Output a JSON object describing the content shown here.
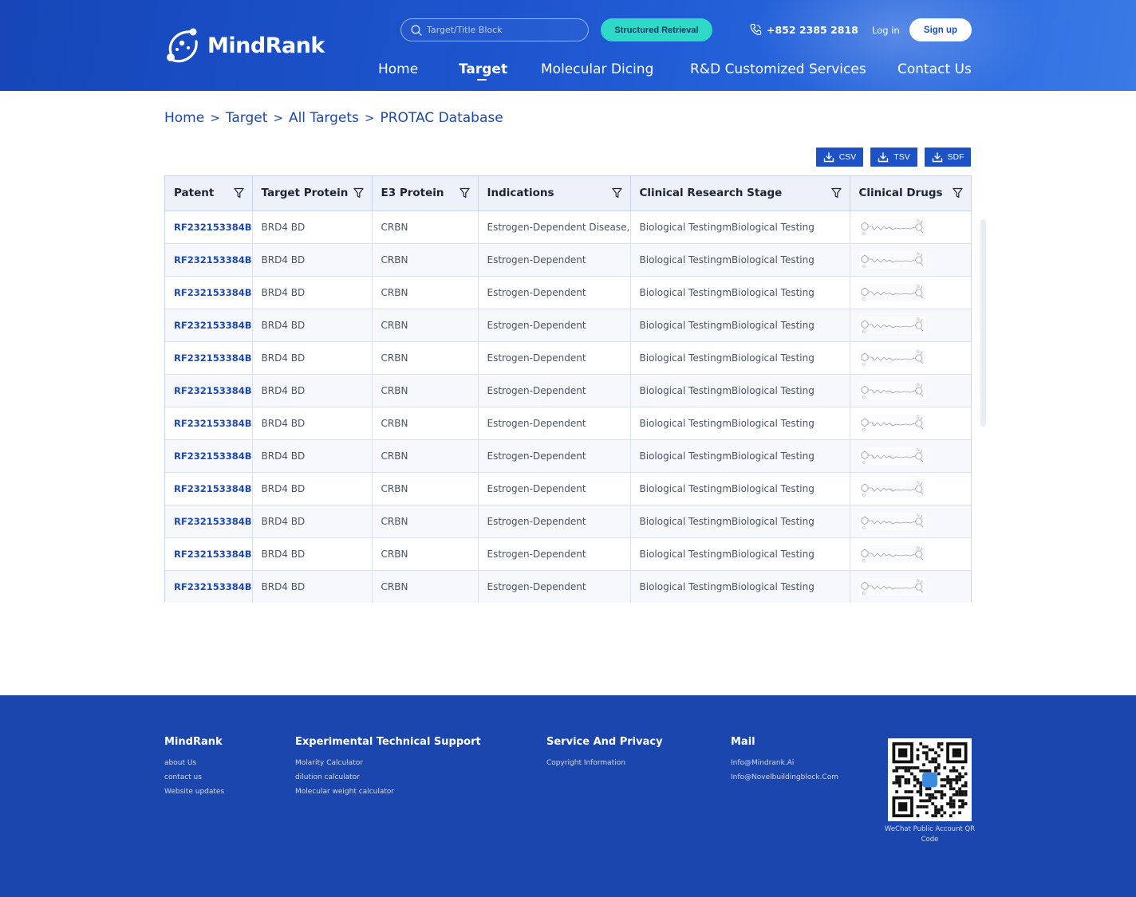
{
  "header": {
    "brand": "MindRank",
    "search_placeholder": "Target/Title Block",
    "structured_button": "Structured Retrieval",
    "phone": "+852 2385 2818",
    "login": "Log in",
    "signup": "Sign up"
  },
  "nav": [
    {
      "label": "Home",
      "active": false
    },
    {
      "label": "Target",
      "active": true
    },
    {
      "label": "Molecular Dicing",
      "active": false
    },
    {
      "label": "R&D Customized Services",
      "active": false
    },
    {
      "label": "Contact Us",
      "active": false
    }
  ],
  "breadcrumb": [
    "Home",
    "Target",
    "All Targets",
    "PROTAC Database"
  ],
  "exports": [
    "CSV",
    "TSV",
    "SDF"
  ],
  "table": {
    "columns": [
      "Patent",
      "Target Protein",
      "E3 Protein",
      "Indications",
      "Clinical Research Stage",
      "Clinical Drugs"
    ],
    "rows": [
      {
        "patent": "RF232153384B",
        "target": "BRD4 BD",
        "e3": "CRBN",
        "indication": "Estrogen-Dependent Disease,I",
        "stage": "Biological TestingmBiological Testing"
      },
      {
        "patent": "RF232153384B",
        "target": "BRD4 BD",
        "e3": "CRBN",
        "indication": "Estrogen-Dependent",
        "stage": "Biological TestingmBiological Testing"
      },
      {
        "patent": "RF232153384B",
        "target": "BRD4 BD",
        "e3": "CRBN",
        "indication": "Estrogen-Dependent",
        "stage": "Biological TestingmBiological Testing"
      },
      {
        "patent": "RF232153384B",
        "target": "BRD4 BD",
        "e3": "CRBN",
        "indication": "Estrogen-Dependent",
        "stage": "Biological TestingmBiological Testing"
      },
      {
        "patent": "RF232153384B",
        "target": "BRD4 BD",
        "e3": "CRBN",
        "indication": "Estrogen-Dependent",
        "stage": "Biological TestingmBiological Testing"
      },
      {
        "patent": "RF232153384B",
        "target": "BRD4 BD",
        "e3": "CRBN",
        "indication": "Estrogen-Dependent",
        "stage": "Biological TestingmBiological Testing"
      },
      {
        "patent": "RF232153384B",
        "target": "BRD4 BD",
        "e3": "CRBN",
        "indication": "Estrogen-Dependent",
        "stage": "Biological TestingmBiological Testing"
      },
      {
        "patent": "RF232153384B",
        "target": "BRD4 BD",
        "e3": "CRBN",
        "indication": "Estrogen-Dependent",
        "stage": "Biological TestingmBiological Testing"
      },
      {
        "patent": "RF232153384B",
        "target": "BRD4 BD",
        "e3": "CRBN",
        "indication": "Estrogen-Dependent",
        "stage": "Biological TestingmBiological Testing"
      },
      {
        "patent": "RF232153384B",
        "target": "BRD4 BD",
        "e3": "CRBN",
        "indication": "Estrogen-Dependent",
        "stage": "Biological TestingmBiological Testing"
      },
      {
        "patent": "RF232153384B",
        "target": "BRD4 BD",
        "e3": "CRBN",
        "indication": "Estrogen-Dependent",
        "stage": "Biological TestingmBiological Testing"
      },
      {
        "patent": "RF232153384B",
        "target": "BRD4 BD",
        "e3": "CRBN",
        "indication": "Estrogen-Dependent",
        "stage": "Biological TestingmBiological Testing"
      }
    ]
  },
  "footer": {
    "columns": [
      {
        "title": "MindRank",
        "links": [
          "about Us",
          "contact us",
          "Website updates"
        ]
      },
      {
        "title": "Experimental Technical Support",
        "links": [
          "Molarity Calculator",
          "dilution calculator",
          "Molecular weight calculator"
        ]
      },
      {
        "title": "Service And Privacy",
        "links": [
          "Copyright Information"
        ]
      },
      {
        "title": "Mail",
        "links": [
          "Info@Mindrank.Ai",
          "Info@Novelbuildingblock.Com"
        ]
      }
    ],
    "qr_caption": "WeChat Public Account QR Code"
  },
  "colors": {
    "header_bg": "#1d55cf",
    "accent_teal": "#2ed9c8",
    "link_blue": "#1c48b4",
    "footer_bg": "#1b46ad",
    "export_btn": "#1d52c6"
  }
}
